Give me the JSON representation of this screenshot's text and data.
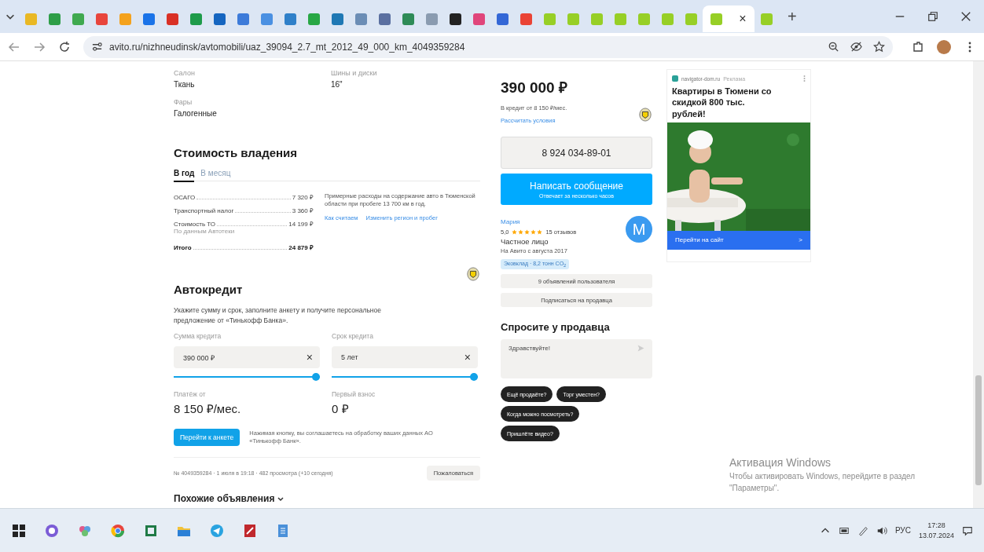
{
  "browser": {
    "tabs": [
      {
        "color": "#e9b824",
        "selected": false
      },
      {
        "color": "#2e9e48",
        "selected": false
      },
      {
        "color": "#3fa94f",
        "selected": false
      },
      {
        "color": "#e8453c",
        "selected": false
      },
      {
        "color": "#f4a21d",
        "selected": false
      },
      {
        "color": "#1a73e8",
        "selected": false
      },
      {
        "color": "#d93025",
        "selected": false
      },
      {
        "color": "#1e9b4a",
        "selected": false
      },
      {
        "color": "#1565c0",
        "selected": false
      },
      {
        "color": "#3d7bd9",
        "selected": false
      },
      {
        "color": "#4a90e2",
        "selected": false
      },
      {
        "color": "#2f80c9",
        "selected": false
      },
      {
        "color": "#28a745",
        "selected": false
      },
      {
        "color": "#1f78b4",
        "selected": false
      },
      {
        "color": "#6b8db5",
        "selected": false
      },
      {
        "color": "#5a6fa0",
        "selected": false
      },
      {
        "color": "#2e8b57",
        "selected": false
      },
      {
        "color": "#8a9bb0",
        "selected": false
      },
      {
        "color": "#222222",
        "selected": false
      },
      {
        "color": "#e0457b",
        "selected": false
      },
      {
        "color": "#3367d6",
        "selected": false
      },
      {
        "color": "#ea4335",
        "selected": false
      },
      {
        "color": "#97cf26",
        "selected": false
      },
      {
        "color": "#97cf26",
        "selected": false
      },
      {
        "color": "#97cf26",
        "selected": false
      },
      {
        "color": "#97cf26",
        "selected": false
      },
      {
        "color": "#97cf26",
        "selected": false
      },
      {
        "color": "#97cf26",
        "selected": false
      },
      {
        "color": "#97cf26",
        "selected": false
      },
      {
        "color": "#97cf26",
        "selected": true
      },
      {
        "color": "#97cf26",
        "selected": false
      }
    ],
    "close_tab": "×",
    "new_tab": "+",
    "url": "avito.ru/nizhneudinsk/avtomobili/uaz_39094_2.7_mt_2012_49_000_km_4049359284"
  },
  "specs": [
    {
      "label": "Салон",
      "value": "Ткань"
    },
    {
      "label": "Шины и диски",
      "value": "16\""
    },
    {
      "label": "Фары",
      "value": "Галогенные"
    }
  ],
  "ownership": {
    "title": "Стоимость владения",
    "tabs": [
      {
        "label": "В год",
        "selected": true
      },
      {
        "label": "В месяц",
        "selected": false
      }
    ],
    "rows": [
      {
        "kind": "item",
        "name": "ОСАГО",
        "value": "7 320 ₽"
      },
      {
        "kind": "item",
        "name": "Транспортный налог",
        "value": "3 360 ₽"
      },
      {
        "kind": "item",
        "name": "Стоимость ТО",
        "value": "14 199 ₽",
        "note": "По данным Автотеки"
      },
      {
        "kind": "total",
        "name": "Итого",
        "value": "24 879 ₽"
      }
    ],
    "description": "Примерные расходы на содержание авто в Тюменской области при пробеге 13 700 км в год.",
    "links": [
      "Как считаем",
      "Изменить регион и пробег"
    ]
  },
  "autocredit": {
    "title": "Автокредит",
    "text": "Укажите сумму и срок, заполните анкету и получите персональное предложение от «Тинькофф Банка».",
    "fields": [
      {
        "label": "Сумма кредита",
        "value": "390 000 ₽",
        "clear": "×",
        "level": 1
      },
      {
        "label": "Срок кредита",
        "value": "5 лет",
        "clear": "×",
        "level": 1
      }
    ],
    "results": [
      {
        "label": "Платёж от",
        "value": "8 150 ₽/мес."
      },
      {
        "label": "Первый взнос",
        "value": "0 ₽"
      }
    ],
    "button": "Перейти к анкете",
    "consent": "Нажимая кнопку, вы соглашаетесь на обработку ваших данных АО «Тинькофф Банк»."
  },
  "footer": {
    "info": "№ 4049359284 · 1 июля в 19:18 · 482 просмотра (+10 сегодня)",
    "report": "Пожаловаться",
    "similar": "Похожие объявления"
  },
  "sidebar": {
    "price": "390 000 ₽",
    "credit": "В кредит от 8 150 ₽/мес.",
    "credit_link": "Рассчитать условия",
    "phone": "8 924 034-89-01",
    "message_button": "Написать сообщение",
    "message_hint": "Отвечает за несколько часов",
    "seller": {
      "name": "Мария",
      "rating": "5,0",
      "stars": 5,
      "reviews": "15 отзывов",
      "type": "Частное лицо",
      "since": "На Авито с августа 2017",
      "eco": "Эковклад · 8,2 тонн CO$_{2}$",
      "initial": "М"
    },
    "seller_buttons": [
      "9 объявлений пользователя",
      "Подписаться на продавца"
    ],
    "ask_title": "Спросите у продавца",
    "ask_value": "Здравствуйте!",
    "chips": [
      "Ещё продаёте?",
      "Торг уместен?",
      "Когда можно посмотреть?",
      "Пришлёте видео?"
    ]
  },
  "ad": {
    "domain": "navigator-dom.ru",
    "label": "Реклама",
    "title": "Квартиры в Тюмени со скидкой 800 тыс. рублей!",
    "link": "Перейти на сайт",
    "link_arrow": ">"
  },
  "activation": {
    "title": "Активация Windows",
    "text": "Чтобы активировать Windows, перейдите в раздел \"Параметры\"."
  },
  "taskbar": {
    "language": "РУС",
    "time": "17:28",
    "date": "13.07.2024"
  }
}
